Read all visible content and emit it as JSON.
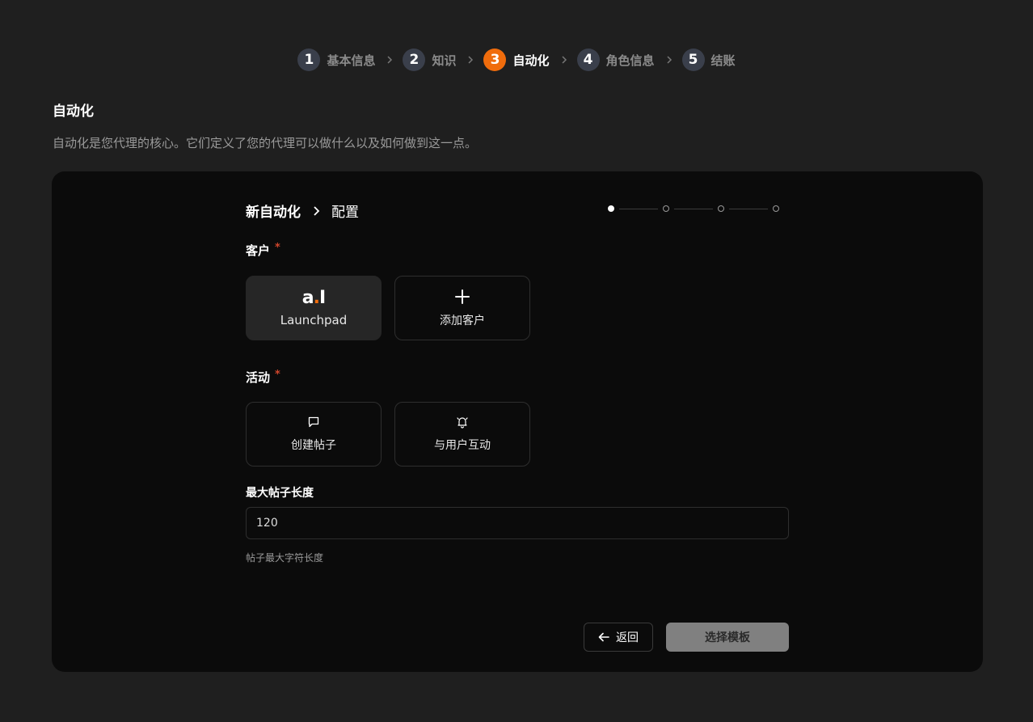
{
  "wizard": {
    "steps": [
      {
        "num": "1",
        "label": "基本信息"
      },
      {
        "num": "2",
        "label": "知识"
      },
      {
        "num": "3",
        "label": "自动化"
      },
      {
        "num": "4",
        "label": "角色信息"
      },
      {
        "num": "5",
        "label": "结账"
      }
    ],
    "active_step": 3
  },
  "page": {
    "title": "自动化",
    "description": "自动化是您代理的核心。它们定义了您的代理可以做什么以及如何做到这一点。"
  },
  "panel": {
    "breadcrumb": {
      "parent": "新自动化",
      "current": "配置"
    },
    "progress": {
      "total": 4,
      "current": 1
    },
    "client": {
      "label": "客户",
      "required": "*",
      "options": [
        {
          "logo_text": "a.I",
          "label": "Launchpad",
          "selected": true
        },
        {
          "icon": "plus-icon",
          "label": "添加客户"
        }
      ]
    },
    "activity": {
      "label": "活动",
      "required": "*",
      "options": [
        {
          "icon": "message-square-icon",
          "label": "创建帖子"
        },
        {
          "icon": "bell-ring-icon",
          "label": "与用户互动"
        }
      ]
    },
    "max_length": {
      "label": "最大帖子长度",
      "value": "120",
      "hint": "帖子最大字符长度"
    },
    "actions": {
      "back": "返回",
      "next": "选择模板"
    }
  },
  "colors": {
    "accent": "#f06c0c",
    "background": "#1f1f1f",
    "panel": "#0b0b0b",
    "required": "#d0462c"
  }
}
